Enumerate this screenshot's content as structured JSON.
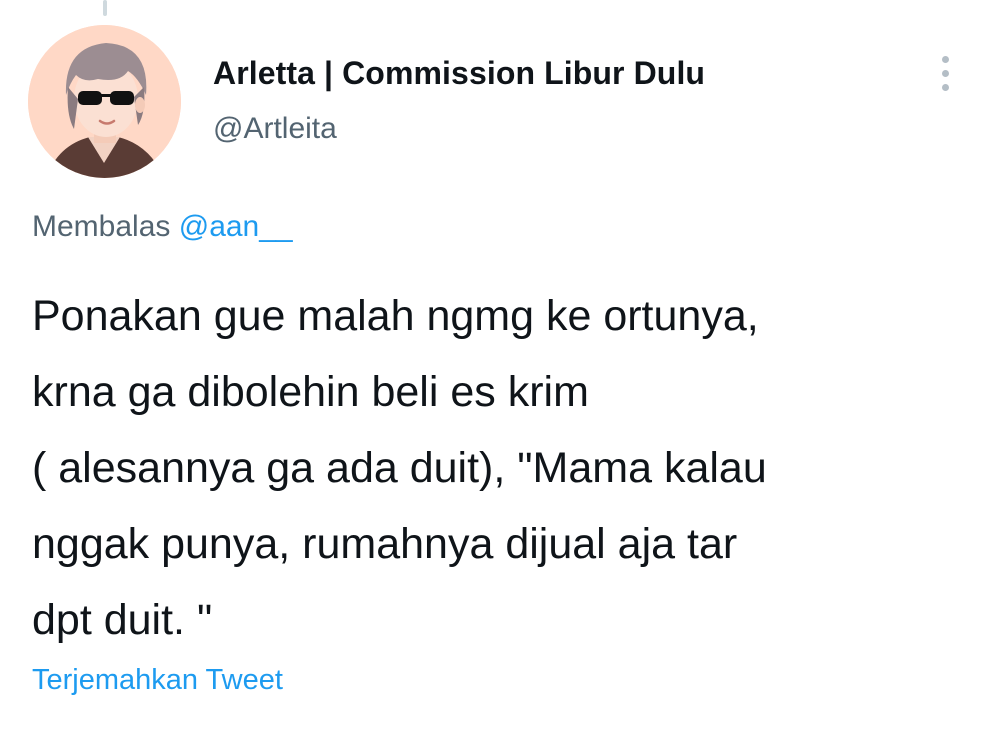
{
  "tweet": {
    "author": {
      "display_name": "Arletta | Commission Libur Dulu",
      "handle": "@Artleita",
      "avatar_icon": "anime-character-sunglasses-avatar"
    },
    "more_icon": "vertical-ellipsis-icon",
    "reply_to": {
      "prefix": "Membalas",
      "mention": "@aan__"
    },
    "text": "Ponakan gue malah ngmg ke ortunya,\nkrna ga dibolehin beli es krim\n( alesannya ga ada duit), \"Mama kalau\nnggak punya, rumahnya dijual aja tar\ndpt duit. \"",
    "translate_label": "Terjemahkan Tweet"
  },
  "colors": {
    "text_primary": "#0f1419",
    "text_secondary": "#536471",
    "link": "#1d9bf0",
    "avatar_bg": "#ffd6c2"
  }
}
